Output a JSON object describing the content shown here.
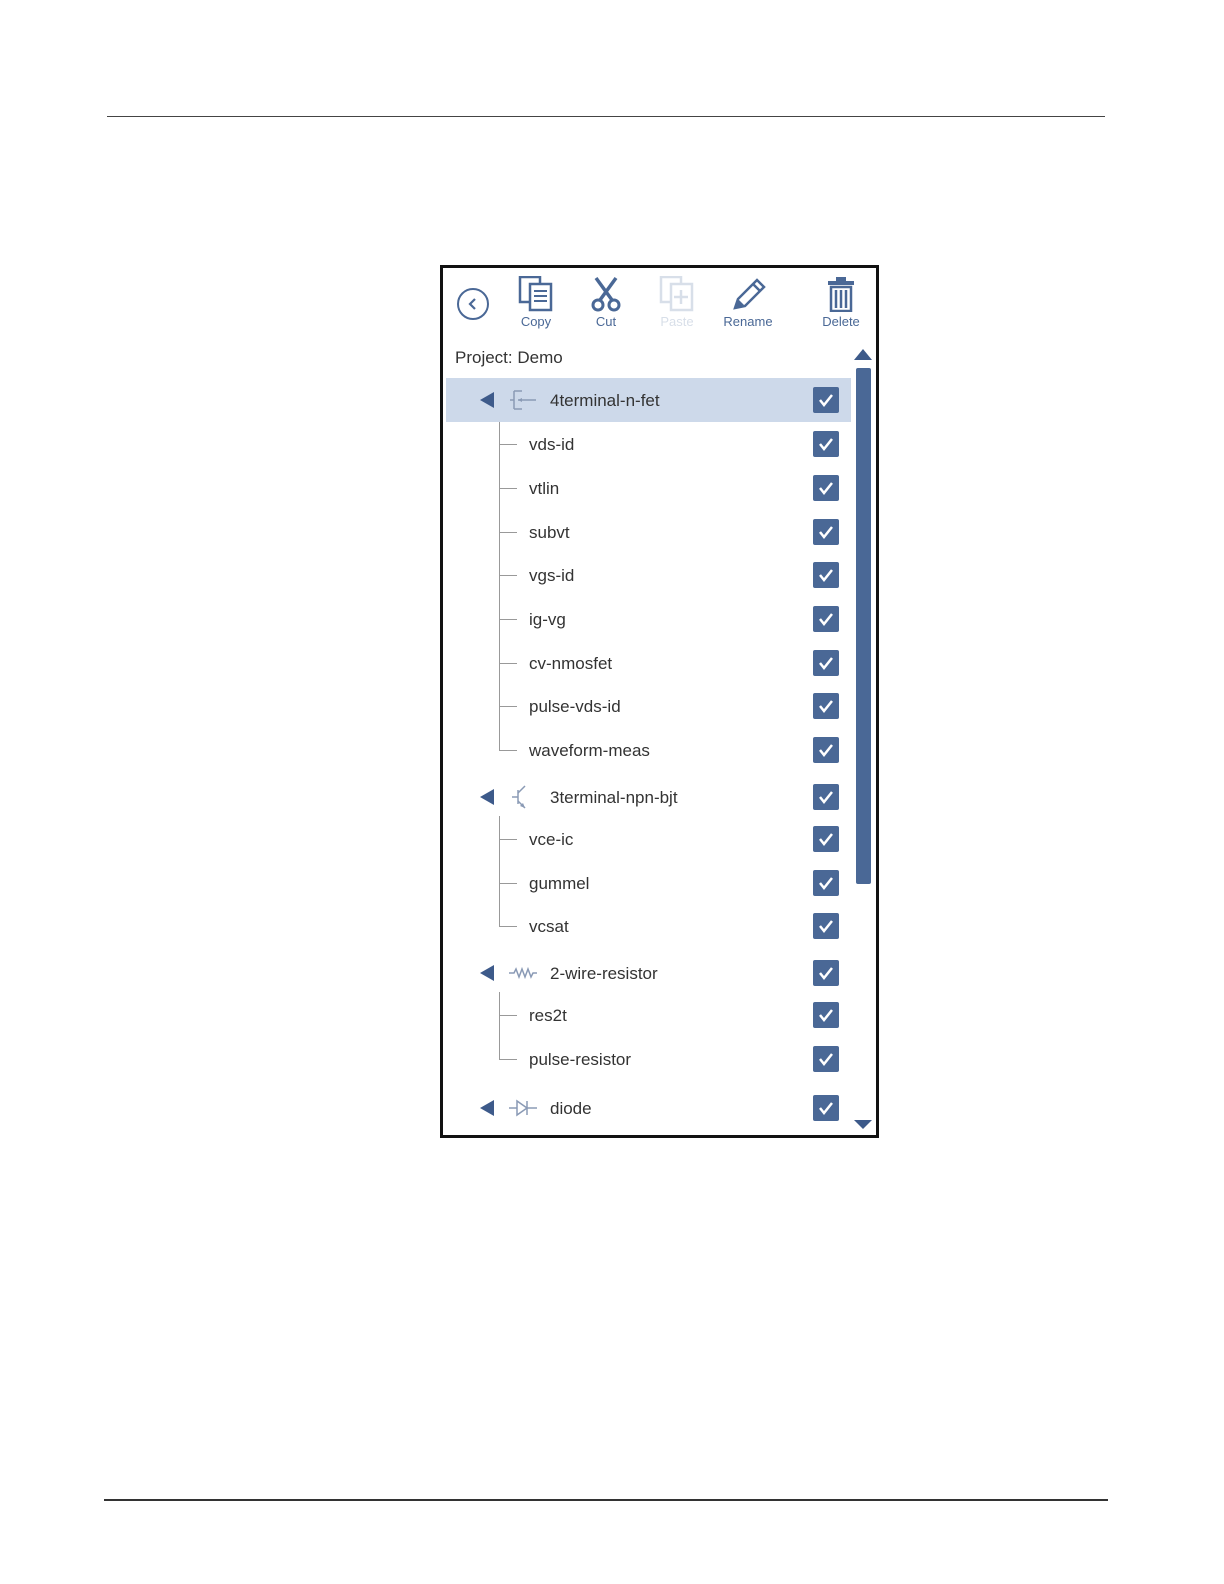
{
  "toolbar": {
    "copy_label": "Copy",
    "cut_label": "Cut",
    "paste_label": "Paste",
    "rename_label": "Rename",
    "delete_label": "Delete",
    "back_icon": "back-arrow-icon"
  },
  "project": {
    "label": "Project: Demo"
  },
  "tree": {
    "groups": [
      {
        "label": "4terminal-n-fet",
        "icon": "nfet-icon",
        "checked": true,
        "selected": true,
        "children": [
          "vds-id",
          "vtlin",
          "subvt",
          "vgs-id",
          "ig-vg",
          "cv-nmosfet",
          "pulse-vds-id",
          "waveform-meas"
        ]
      },
      {
        "label": "3terminal-npn-bjt",
        "icon": "npn-bjt-icon",
        "checked": true,
        "children": [
          "vce-ic",
          "gummel",
          "vcsat"
        ]
      },
      {
        "label": "2-wire-resistor",
        "icon": "resistor-icon",
        "checked": true,
        "children": [
          "res2t",
          "pulse-resistor"
        ]
      },
      {
        "label": "diode",
        "icon": "diode-icon",
        "checked": true,
        "children": []
      }
    ]
  },
  "colors": {
    "accent": "#4a6896",
    "selected_row": "#cdd9ea",
    "disabled": "#d8dfe9"
  }
}
